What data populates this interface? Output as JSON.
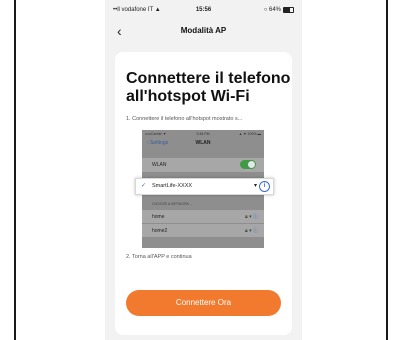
{
  "status_bar": {
    "carrier": "••ll vodafone IT ▲",
    "time": "15:56",
    "battery": "○ 64%"
  },
  "nav": {
    "back_icon": "‹",
    "title": "Modalità AP"
  },
  "card": {
    "title": "Connettere il telefono all'hotspot Wi-Fi",
    "step1": "1. Connettere il telefono all'hotspot mostrato s...",
    "step2": "2. Torna all'APP e continua",
    "button_label": "Connettere Ora"
  },
  "illustration": {
    "status_left": "•••••Carrier ▼",
    "status_time": "3:48 PM",
    "status_right": "▲ ▼ 100% ▬",
    "back": "‹ Settings",
    "title": "WLAN",
    "wlan_label": "WLAN",
    "selected_ssid": "SmartLife-XXXX",
    "section_label": "CHOOSE A NETWORK...",
    "networks": [
      "home",
      "home2"
    ]
  },
  "colors": {
    "accent": "#f27a2e",
    "link_blue": "#3a6ad8",
    "toggle_green": "#3f9b46"
  },
  "icons": {
    "back": "chevron-left-icon",
    "check": "checkmark-icon",
    "wifi": "wifi-icon",
    "info": "info-icon",
    "lock": "lock-icon"
  }
}
